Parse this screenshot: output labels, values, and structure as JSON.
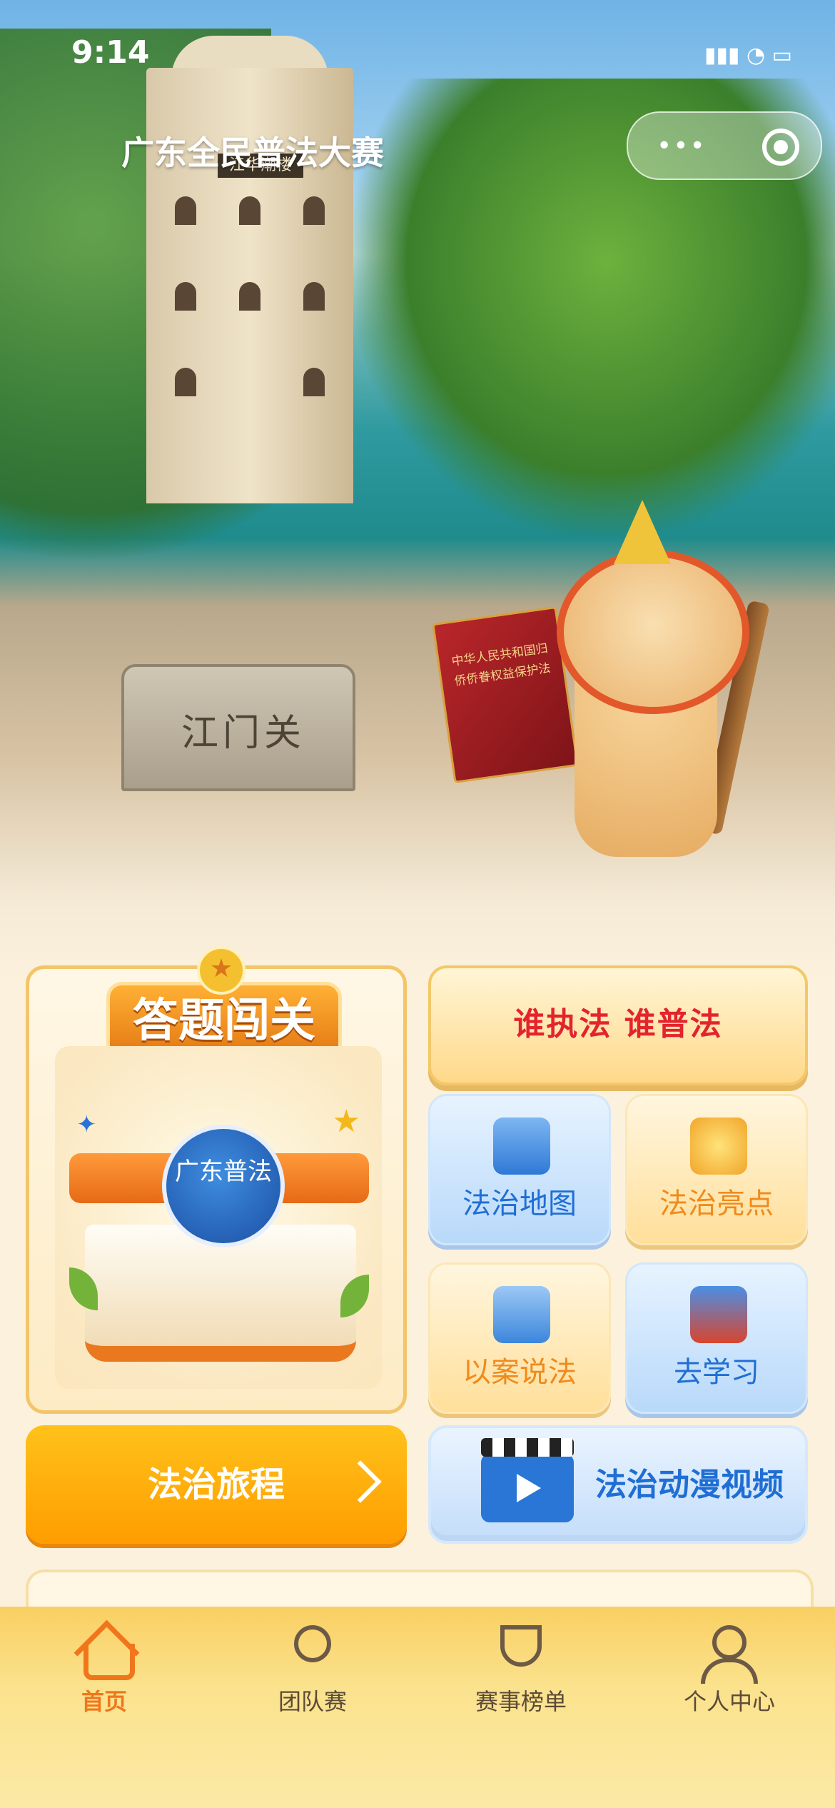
{
  "status_bar": {
    "time": "9:14"
  },
  "nav": {
    "title": "广东全民普法大赛"
  },
  "hero": {
    "gate_text": "江门关",
    "tower_plaque": "江华潮楼",
    "book_text": "中华人民共和国归侨侨眷权益保护法"
  },
  "quiz": {
    "badge": "答题闯关",
    "seal_text": "广东普法"
  },
  "slogan": "谁执法 谁普法",
  "tiles": [
    {
      "label": "法治地图",
      "icon": "clipboard-map-icon"
    },
    {
      "label": "法治亮点",
      "icon": "lightbulb-book-icon"
    },
    {
      "label": "以案说法",
      "icon": "law-scroll-icon"
    },
    {
      "label": "去学习",
      "icon": "books-stack-icon"
    }
  ],
  "journey": {
    "label": "法治旅程"
  },
  "video": {
    "label": "法治动漫视频"
  },
  "tabbar": {
    "items": [
      {
        "label": "首页",
        "icon": "home-icon",
        "active": true
      },
      {
        "label": "团队赛",
        "icon": "team-icon",
        "active": false
      },
      {
        "label": "赛事榜单",
        "icon": "trophy-icon",
        "active": false
      },
      {
        "label": "个人中心",
        "icon": "user-icon",
        "active": false
      }
    ]
  },
  "colors": {
    "accent": "#f0761c",
    "slogan_red": "#e3232d",
    "blue_text": "#1f6ed4",
    "orange_button": "#ffb40f"
  }
}
